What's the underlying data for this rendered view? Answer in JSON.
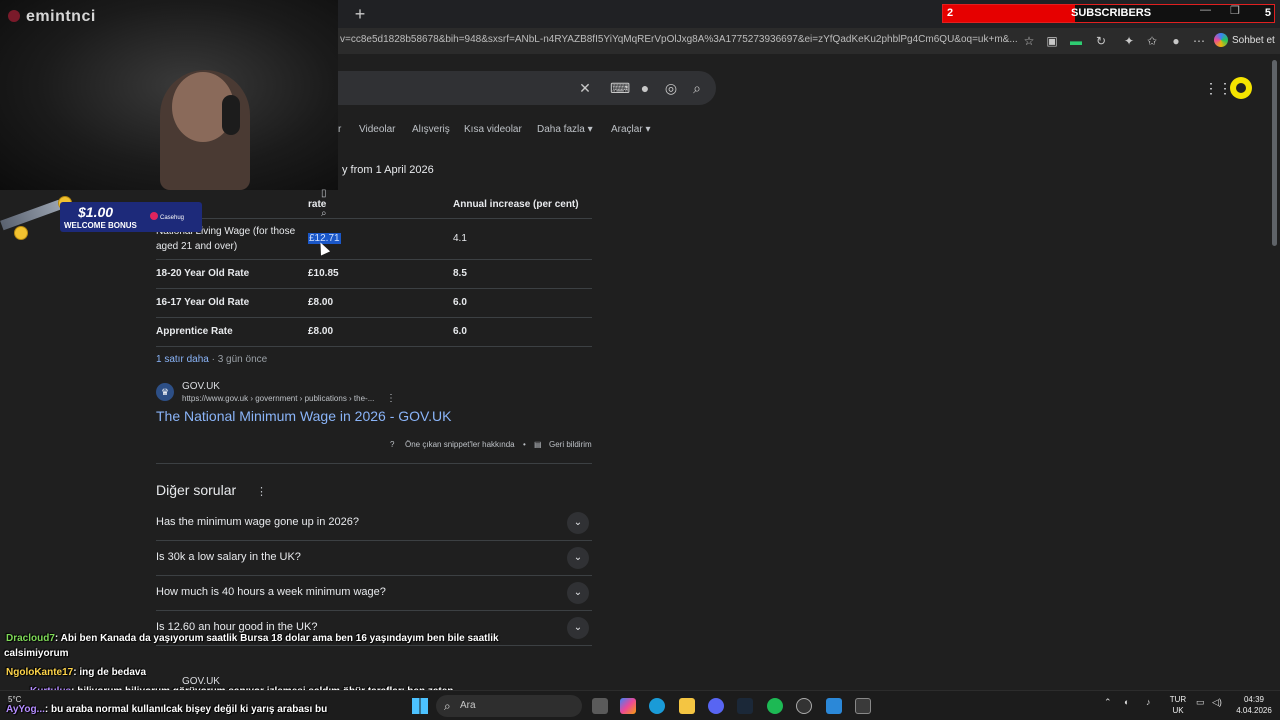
{
  "browser": {
    "new_tab": "+",
    "url": "v=cc8e5d1828b58678&bih=948&sxsrf=ANbL-n4RYAZB8fI5YiYqMqRErVpOlJxg8A%3A1775273936697&ei=zYfQadKeKu2phblPg4Cm6QU&oq=uk+m&...",
    "copilot_label": "Sohbet et"
  },
  "subscriber_goal": {
    "count": "2",
    "label": "SUBSCRIBERS",
    "goal": "5",
    "progress_fraction": 0.4
  },
  "search_tabs": [
    "r",
    "Videolar",
    "Alışveriş",
    "Kısa videolar",
    "Daha fazla ▾",
    "Araçlar ▾"
  ],
  "snippet": {
    "title": "y from 1 April 2026",
    "table": {
      "headers": [
        "",
        "rate",
        "Annual increase (per cent)"
      ],
      "rows": [
        {
          "label": "National Living Wage (for those aged 21 and over)",
          "rate": "£12.71",
          "increase": "4.1"
        },
        {
          "label": "18-20 Year Old Rate",
          "rate": "£10.85",
          "increase": "8.5"
        },
        {
          "label": "16-17 Year Old Rate",
          "rate": "£8.00",
          "increase": "6.0"
        },
        {
          "label": "Apprentice Rate",
          "rate": "£8.00",
          "increase": "6.0"
        }
      ]
    },
    "more_rows": "1 satır daha",
    "age": "· 3 gün önce"
  },
  "source": {
    "name": "GOV.UK",
    "path": "https://www.gov.uk › government › publications › the-...",
    "title": "The National Minimum Wage in 2026 - GOV.UK",
    "about_label": "Öne çıkan snippet'ler hakkında",
    "feedback_label": "Geri bildirim"
  },
  "people_also_ask": {
    "title": "Diğer sorular",
    "questions": [
      "Has the minimum wage gone up in 2026?",
      "Is 30k a low salary in the UK?",
      "How much is 40 hours a week minimum wage?",
      "Is 12.60 an hour good in the UK?"
    ],
    "next_source": "GOV.UK"
  },
  "stream": {
    "streamer": "emintnci",
    "ad_amount": "$1.00",
    "ad_bonus": "WELCOME BONUS",
    "ad_brand": "Casehug"
  },
  "chat": [
    {
      "user": "Dracloud7",
      "text": ": Abi ben Kanada da yaşıyorum saatlik Bursa 18 dolar ama ben 16 yaşındayım ben bile saatlik",
      "cont": "calsimiyorum"
    },
    {
      "user": "NgoloKante17",
      "text": ": ing de bedava"
    },
    {
      "user": "Kurtulus",
      "text": ": biliyorum biliyorum görüyorum sanıyor izlemesi saldım öbür tarafları ben zaten"
    },
    {
      "user": "AyYog...",
      "text": ": bu araba normal kullanılcak bişey değil ki yarış arabası bu"
    }
  ],
  "taskbar": {
    "search_placeholder": "Ara",
    "weather": "5°C",
    "lang_top": "TUR",
    "lang_bottom": "UK",
    "time": "04:39",
    "date": "4.04.2026"
  }
}
